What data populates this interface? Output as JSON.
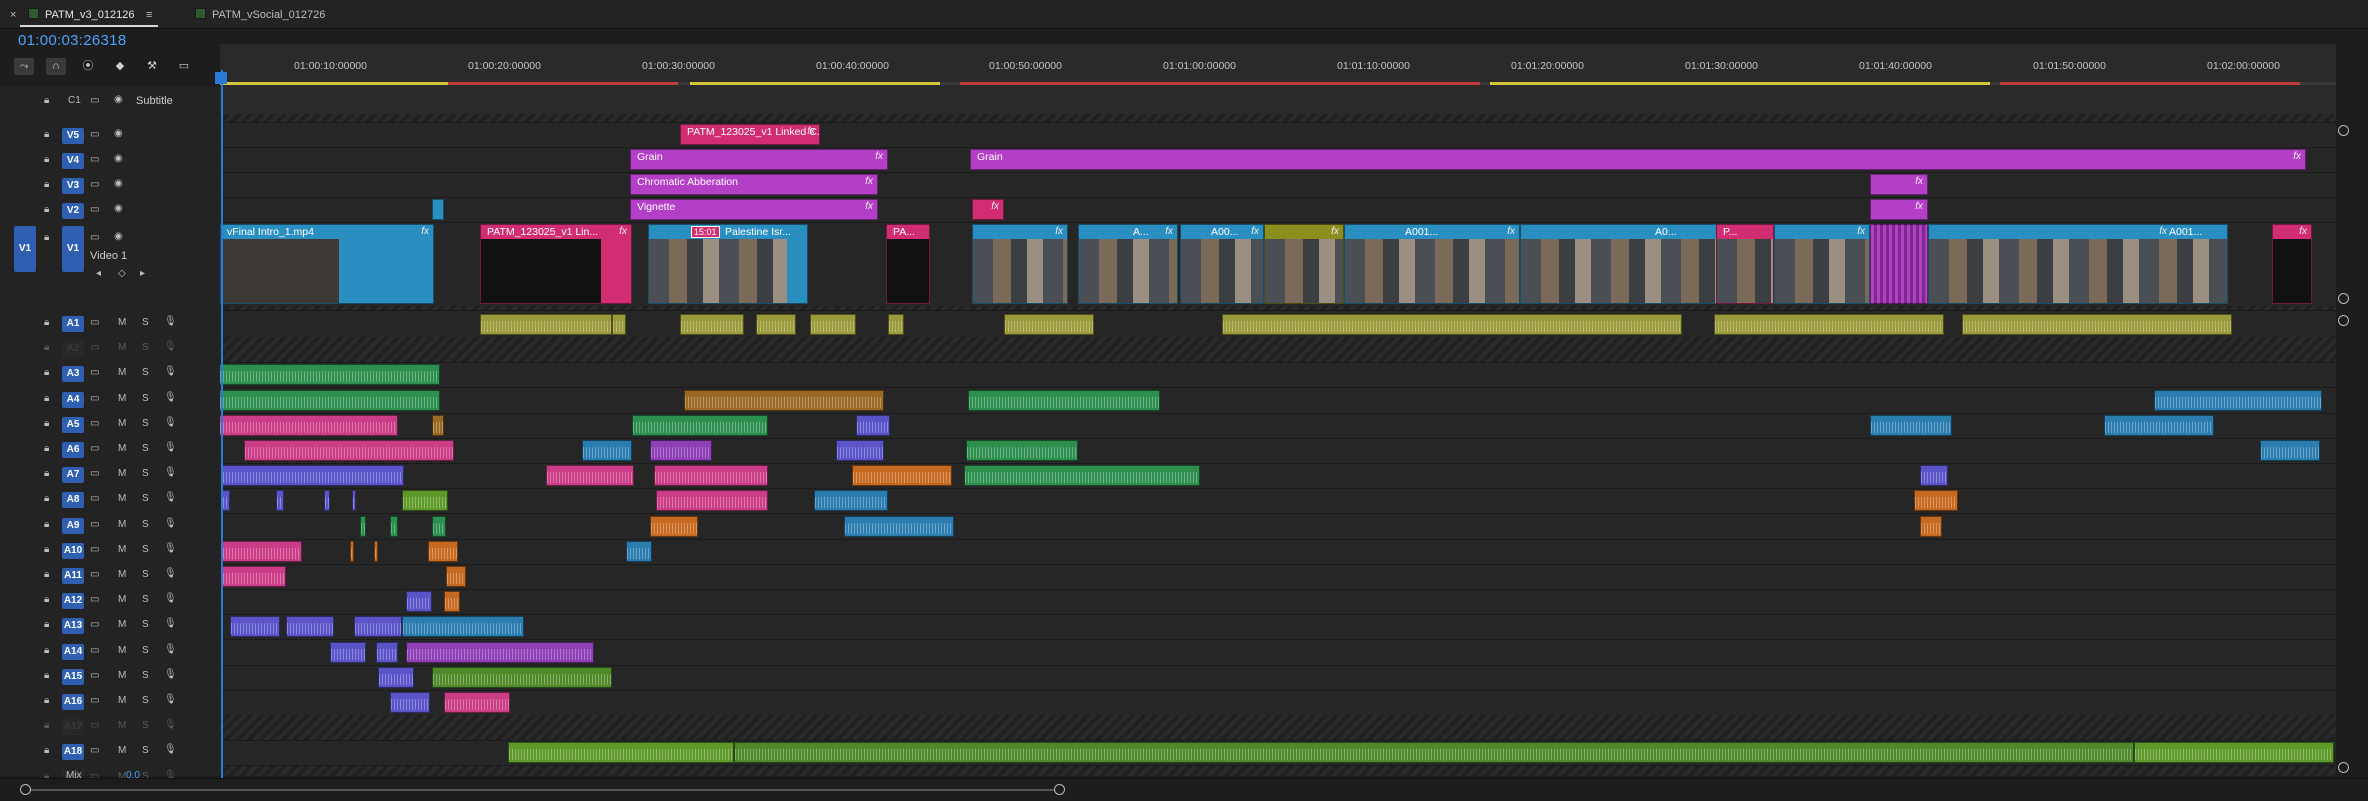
{
  "tabs": [
    {
      "label": "PATM_v3_012126",
      "menu": "≡",
      "close": "×"
    },
    {
      "label": "PATM_vSocial_012726"
    }
  ],
  "timecode": "01:00:03:26318",
  "tools": [
    "⤳",
    "∩",
    "⦿",
    "◆",
    "⚒",
    "▭"
  ],
  "ruler": {
    "ticks": [
      "01:00:10:00000",
      "01:00:20:00000",
      "01:00:30:00000",
      "01:00:40:00000",
      "01:00:50:00000",
      "01:01:00:00000",
      "01:01:10:00000",
      "01:01:20:00000",
      "01:01:30:00000",
      "01:01:40:00000",
      "01:01:50:00000",
      "01:02:00:00000"
    ]
  },
  "subtitle_track": {
    "name": "C1",
    "label": "Subtitle"
  },
  "video_tracks": [
    {
      "id": "V5"
    },
    {
      "id": "V4"
    },
    {
      "id": "V3"
    },
    {
      "id": "V2"
    },
    {
      "id": "V1",
      "source": "V1",
      "name": "Video 1"
    }
  ],
  "audio_tracks": [
    "A1",
    "A2",
    "A3",
    "A4",
    "A5",
    "A6",
    "A7",
    "A8",
    "A9",
    "A10",
    "A11",
    "A12",
    "A13",
    "A14",
    "A15",
    "A16",
    "A17",
    "A18",
    "A19"
  ],
  "audio_letters": {
    "m": "M",
    "s": "S"
  },
  "mix_label": "Mix",
  "mix_value": "0.0",
  "clips": {
    "v5_linked": "PATM_123025_v1 Linked C...",
    "grain": "Grain",
    "grain2": "Grain",
    "chromatic": "Chromatic Abberation",
    "vignette": "Vignette",
    "v1_intro": "vFinal Intro_1.mp4",
    "v1_patm": "PATM_123025_v1 Lin...",
    "v1_palestine": "Palestine Isr...",
    "v1_pa": "PA...",
    "v1_a": "A...",
    "v1_a00": "A00...",
    "v1_a001": "A001...",
    "v1_a0": "A0...",
    "v1_p": "P...",
    "v1_a001b": "A001...",
    "badge": "15:01",
    "fx": "fx"
  },
  "colors": {
    "accent": "#2a7bd8",
    "pink": "#d12d72",
    "magenta": "#b43fc7",
    "blue": "#2a8fc0",
    "audio_yellow": "#9b9a3a"
  }
}
